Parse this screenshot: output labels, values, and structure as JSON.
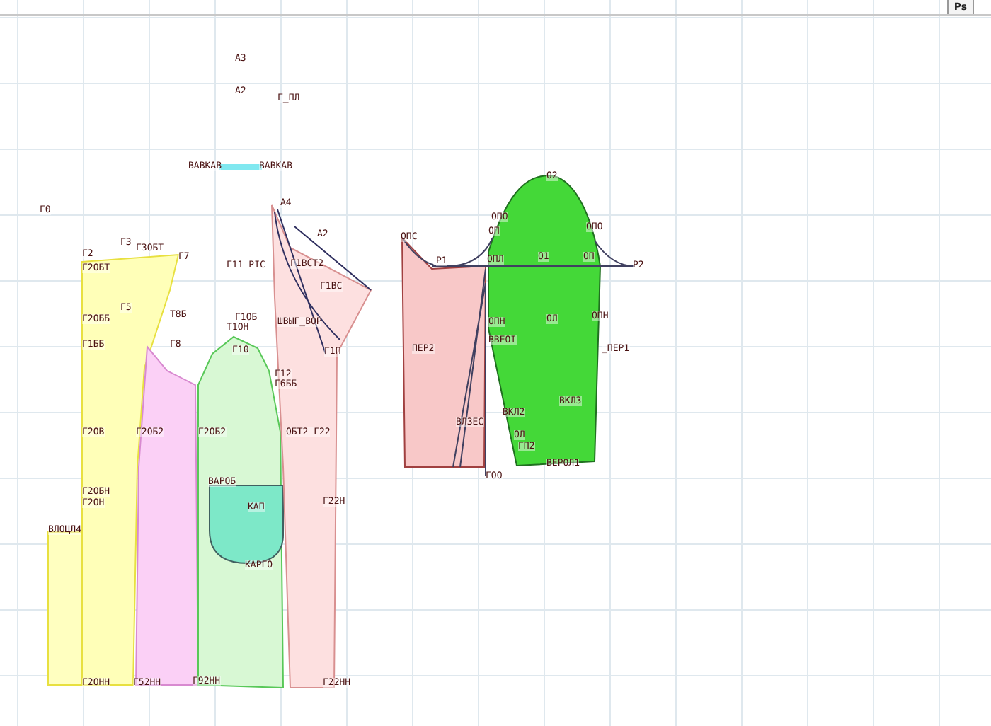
{
  "corner_tab": {
    "label": "Ps"
  },
  "labels": [
    "А3",
    "А2",
    "Г_ПЛ",
    "ВАВКАВ",
    "ВАВКАВ",
    "Г0",
    "А4",
    "Г2",
    "Г3",
    "Г3ОБТ",
    "Г7",
    "Г2ОБТ",
    "Г11 РІС",
    "А2",
    "Г1ВСТ2",
    "Г1ВС",
    "Г5",
    "Г2ОББ",
    "Т8Б",
    "Г1ББ",
    "Г8",
    "Г1ОБ",
    "Т1ОН",
    "Г10",
    "ШВЫГ_ВОР",
    "Г1П",
    "Г12",
    "Г6ББ",
    "Г2ОВ",
    "Г2ОБ2",
    "Г2ОБ2",
    "ОБТ2 Г22",
    "Г2ОБН",
    "Г2ОН",
    "Г22Н",
    "ВАРОБ",
    "КАП",
    "КАРГО",
    "ВЛОЦЛ4",
    "Г2ОНН",
    "Г52НН",
    "Г92НН",
    "Г22НН",
    "ОПС",
    "О2",
    "ОПО",
    "ОП",
    "ОПЛ",
    "О1",
    "ОПО",
    "ОП",
    "Р1",
    "Р2",
    "ОПН",
    "ОЛ",
    "ОПН",
    "ПЕР2",
    "_ПЕР1",
    "ВВЕОІ",
    "ВКЛЗ",
    "ВКЛ2",
    "ВЛЗЕС",
    "ОЛ",
    "ГП2",
    "ГОО",
    "ВЕРОЛ1"
  ]
}
